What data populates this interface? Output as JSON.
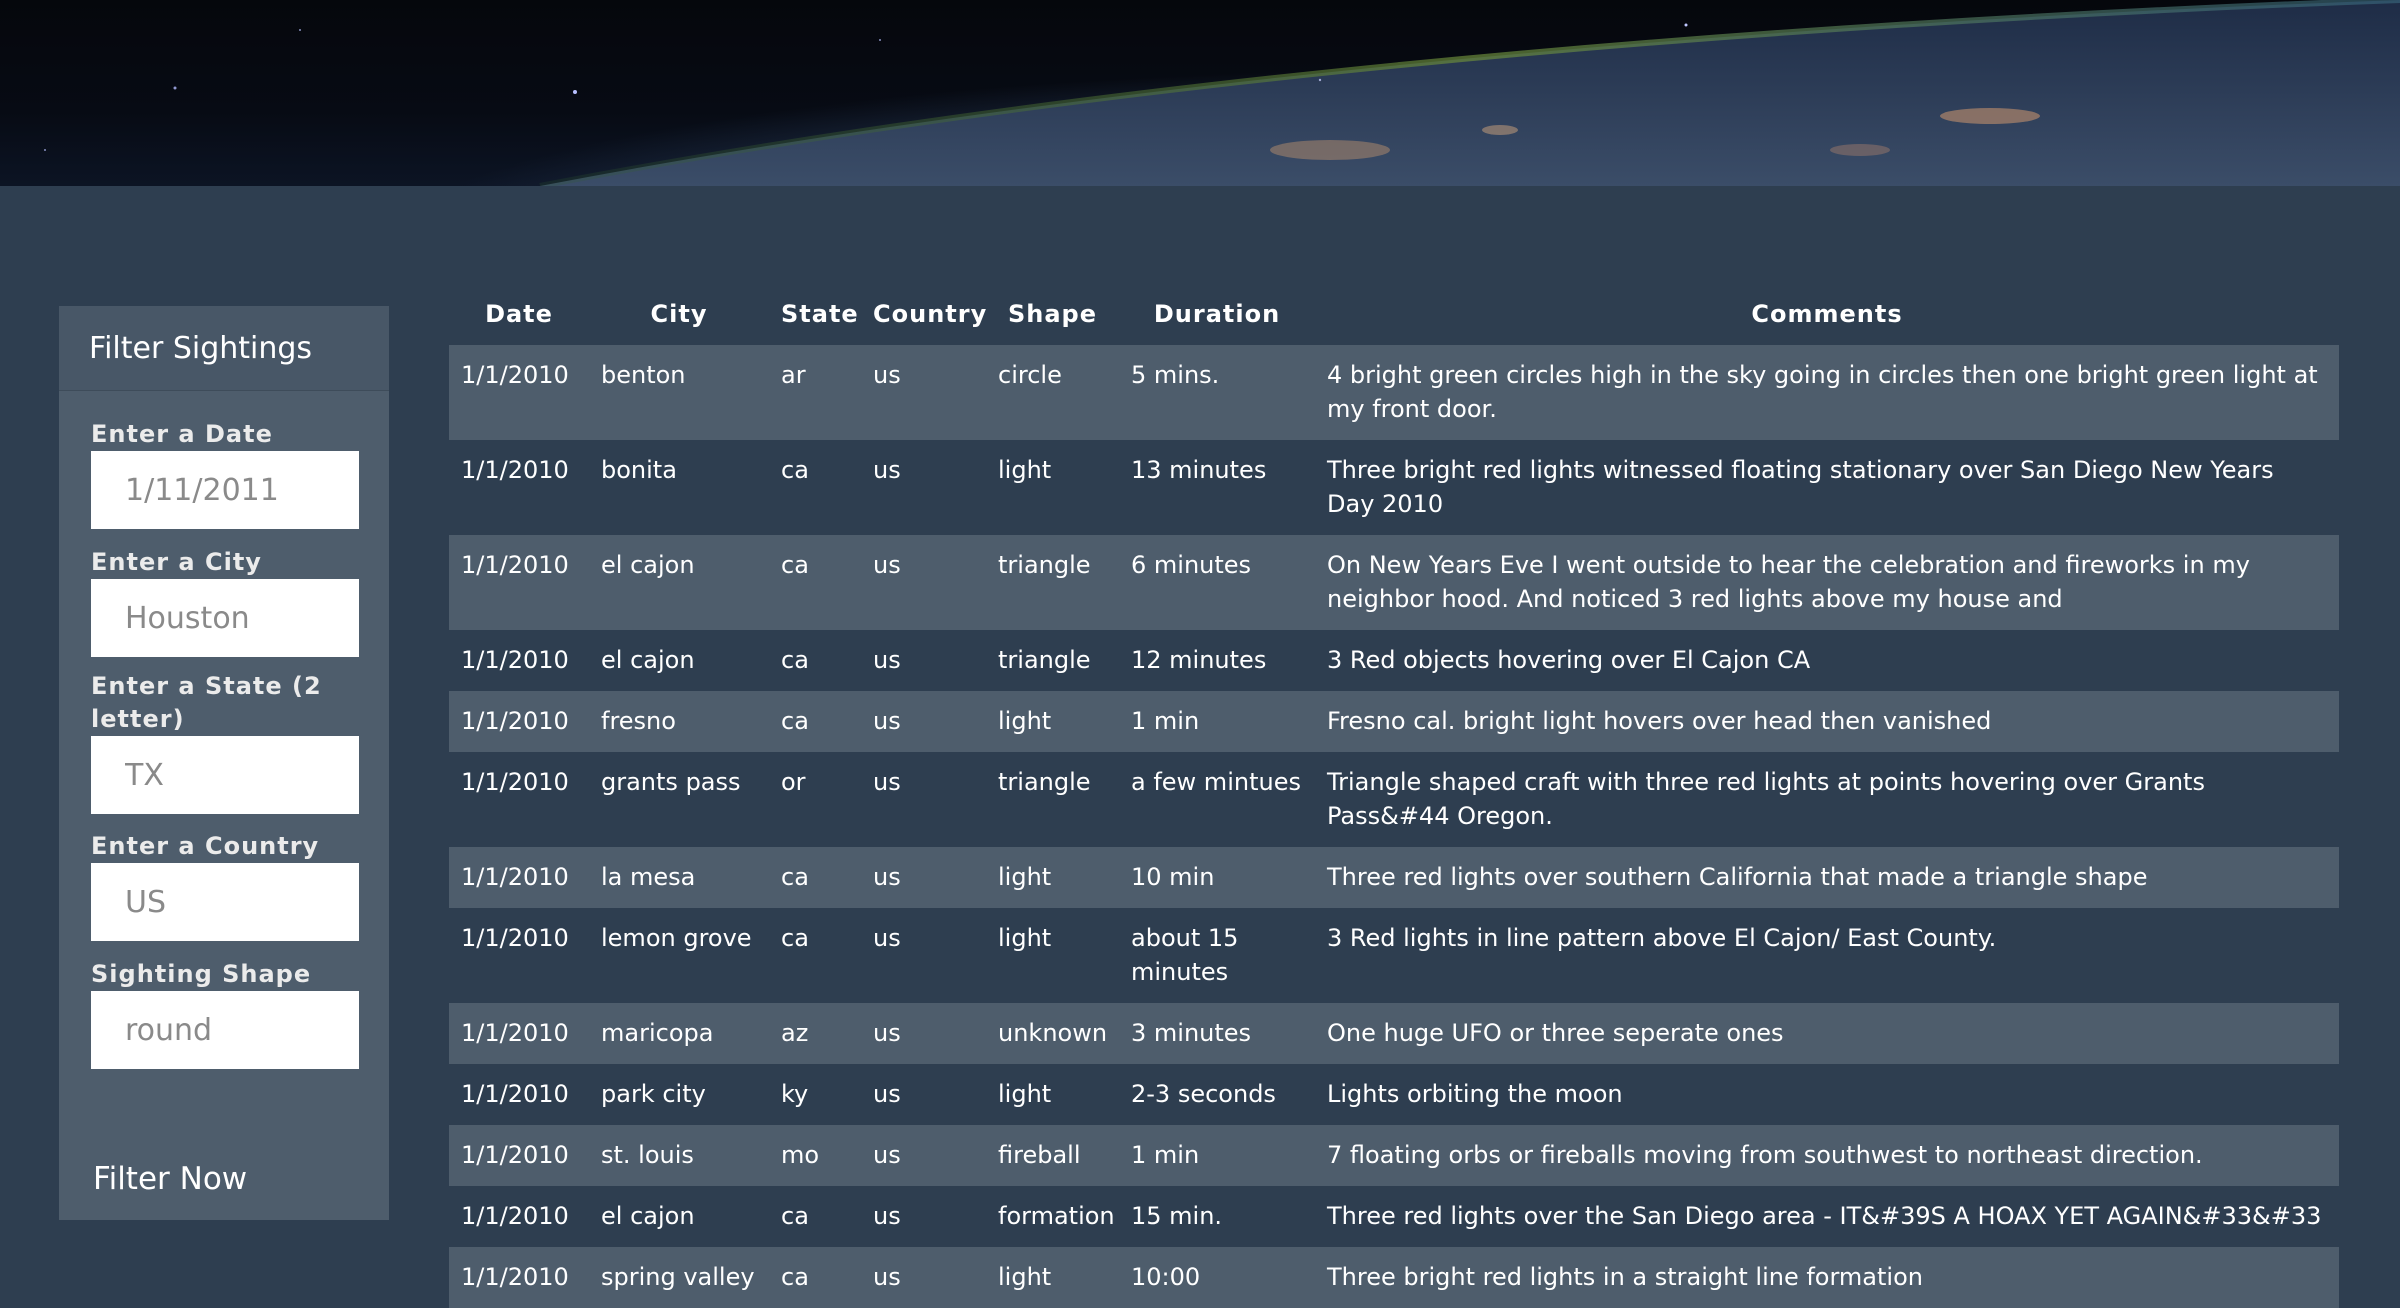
{
  "filter": {
    "title": "Filter Sightings",
    "date_label": "Enter a Date",
    "date_placeholder": "1/11/2011",
    "city_label": "Enter a City",
    "city_placeholder": "Houston",
    "state_label": "Enter a State (2 letter)",
    "state_placeholder": "TX",
    "country_label": "Enter a Country",
    "country_placeholder": "US",
    "shape_label": "Sighting Shape",
    "shape_placeholder": "round",
    "button_label": "Filter Now"
  },
  "table": {
    "headers": [
      "Date",
      "City",
      "State",
      "Country",
      "Shape",
      "Duration",
      "Comments"
    ],
    "rows": [
      [
        "1/1/2010",
        "benton",
        "ar",
        "us",
        "circle",
        "5 mins.",
        "4 bright green circles high in the sky going in circles then one bright green light at my front door."
      ],
      [
        "1/1/2010",
        "bonita",
        "ca",
        "us",
        "light",
        "13 minutes",
        "Three bright red lights witnessed floating stationary over San Diego New Years Day 2010"
      ],
      [
        "1/1/2010",
        "el cajon",
        "ca",
        "us",
        "triangle",
        "6 minutes",
        "On New Years Eve I went outside to hear the celebration and fireworks in my neighbor hood. And noticed 3 red lights above my house and"
      ],
      [
        "1/1/2010",
        "el cajon",
        "ca",
        "us",
        "triangle",
        "12 minutes",
        "3 Red objects hovering over El Cajon CA"
      ],
      [
        "1/1/2010",
        "fresno",
        "ca",
        "us",
        "light",
        "1 min",
        "Fresno cal. bright light hovers over head then vanished"
      ],
      [
        "1/1/2010",
        "grants pass",
        "or",
        "us",
        "triangle",
        "a few mintues",
        "Triangle shaped craft with three red lights at points hovering over Grants Pass&#44 Oregon."
      ],
      [
        "1/1/2010",
        "la mesa",
        "ca",
        "us",
        "light",
        "10 min",
        "Three red lights over southern California that made a triangle shape"
      ],
      [
        "1/1/2010",
        "lemon grove",
        "ca",
        "us",
        "light",
        "about 15 minutes",
        "3 Red lights in line pattern above El Cajon/ East County."
      ],
      [
        "1/1/2010",
        "maricopa",
        "az",
        "us",
        "unknown",
        "3 minutes",
        "One huge UFO or three seperate ones"
      ],
      [
        "1/1/2010",
        "park city",
        "ky",
        "us",
        "light",
        "2-3 seconds",
        "Lights orbiting the moon"
      ],
      [
        "1/1/2010",
        "st. louis",
        "mo",
        "us",
        "fireball",
        "1 min",
        "7 floating orbs or fireballs moving from southwest to northeast direction."
      ],
      [
        "1/1/2010",
        "el cajon",
        "ca",
        "us",
        "formation",
        "15 min.",
        "Three red lights over the San Diego area - IT&#39S A HOAX YET AGAIN&#33&#33"
      ],
      [
        "1/1/2010",
        "spring valley",
        "ca",
        "us",
        "light",
        "10:00",
        "Three bright red lights in a straight line formation"
      ]
    ]
  }
}
